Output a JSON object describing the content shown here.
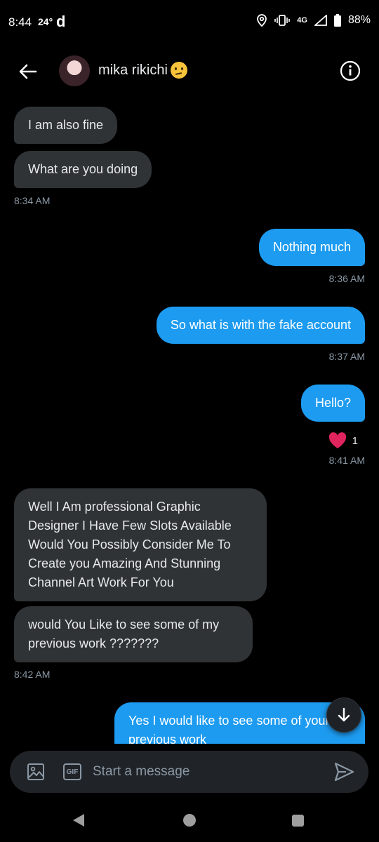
{
  "status_bar": {
    "time": "8:44",
    "temperature": "24°",
    "app_glyph": "d",
    "battery": "88%",
    "network": "4G"
  },
  "header": {
    "contact_name": "mika rikichi",
    "back_icon": "arrow-left-icon",
    "info_icon": "info-circle-icon"
  },
  "messages": [
    {
      "direction": "in",
      "text": "I am also fine"
    },
    {
      "direction": "in",
      "text": "What are you doing"
    },
    {
      "direction": "out",
      "text": "Nothing much"
    },
    {
      "direction": "out",
      "text": "So what is with the fake account"
    },
    {
      "direction": "out",
      "text": "Hello?"
    },
    {
      "direction": "in",
      "text": "Well I Am  professional Graphic Designer I Have Few Slots Available Would You Possibly Consider Me To Create you Amazing And Stunning Channel Art Work For You"
    },
    {
      "direction": "in",
      "text": "would You Like to see some of my previous work ???????"
    },
    {
      "direction": "out",
      "text": "Yes I would like to see some of your previous work"
    }
  ],
  "timestamps": [
    "8:34 AM",
    "8:36 AM",
    "8:37 AM",
    "8:41 AM",
    "8:42 AM"
  ],
  "reaction": {
    "emoji": "heart",
    "count": "1",
    "color": "#e0245e"
  },
  "composer": {
    "placeholder": "Start a message",
    "gif_label": "GIF"
  },
  "colors": {
    "outgoing_bubble": "#1d9bf0",
    "incoming_bubble": "#2f3336",
    "background": "#000000",
    "timestamp": "#8b98a5"
  }
}
